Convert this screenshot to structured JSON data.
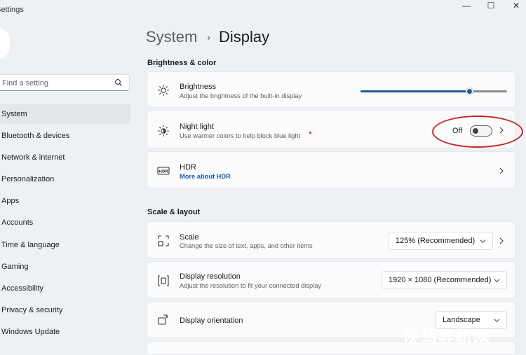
{
  "window": {
    "title": "Settings",
    "controls": {
      "minimize": "—",
      "maximize": "☐",
      "close": "✕"
    }
  },
  "search": {
    "placeholder": "Find a setting",
    "value": ""
  },
  "sidebar": {
    "items": [
      {
        "label": "System",
        "active": true
      },
      {
        "label": "Bluetooth & devices"
      },
      {
        "label": "Network & internet"
      },
      {
        "label": "Personalization"
      },
      {
        "label": "Apps"
      },
      {
        "label": "Accounts"
      },
      {
        "label": "Time & language"
      },
      {
        "label": "Gaming"
      },
      {
        "label": "Accessibility"
      },
      {
        "label": "Privacy & security"
      },
      {
        "label": "Windows Update"
      }
    ]
  },
  "breadcrumb": {
    "parent": "System",
    "separator": "›",
    "current": "Display"
  },
  "sections": {
    "brightness_color": {
      "title": "Brightness & color",
      "brightness": {
        "title": "Brightness",
        "description": "Adjust the brightness of the built-in display",
        "level": 0.74,
        "accent": "#1d5c96"
      },
      "night_light": {
        "title": "Night light",
        "description": "Use warmer colors to help block blue light",
        "state": "Off",
        "highlight_color": "#c8242a"
      },
      "hdr": {
        "title": "HDR",
        "link": "More about HDR"
      }
    },
    "scale_layout": {
      "title": "Scale & layout",
      "scale": {
        "title": "Scale",
        "description": "Change the size of text, apps, and other items",
        "value": "125% (Recommended)"
      },
      "resolution": {
        "title": "Display resolution",
        "description": "Adjust the resolution to fit your connected display",
        "value": "1920 × 1080 (Recommended)"
      },
      "orientation": {
        "title": "Display orientation",
        "value": "Landscape"
      }
    }
  },
  "watermark": "快马导航网"
}
